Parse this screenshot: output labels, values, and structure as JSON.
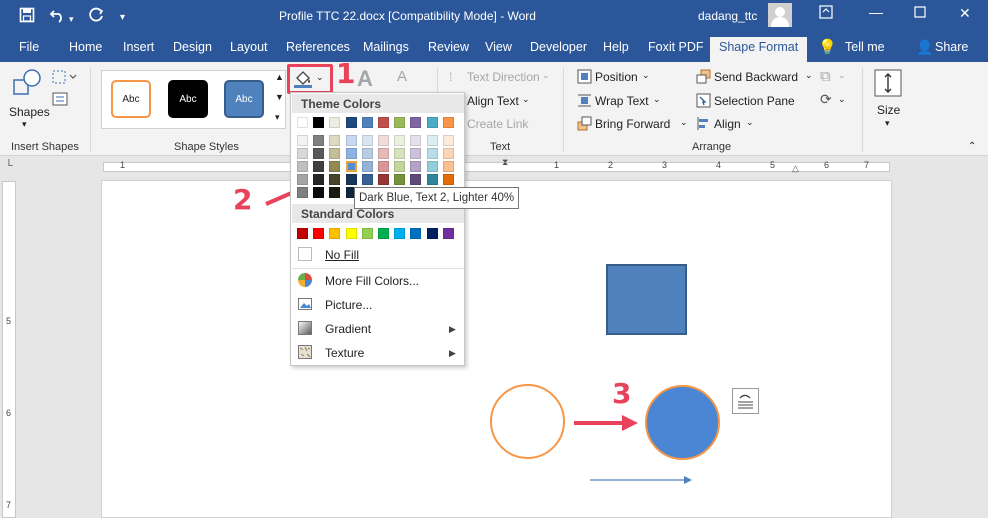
{
  "title_bar": {
    "document_title": "Profile TTC 22.docx [Compatibility Mode]  -  Word",
    "user_name": "dadang_ttc",
    "save_icon": "save-icon",
    "undo_icon": "undo-icon",
    "redo_icon": "redo-icon",
    "quick_access_icon": "customize-quick-access-icon"
  },
  "tabs": [
    "File",
    "Home",
    "Insert",
    "Design",
    "Layout",
    "References",
    "Mailings",
    "Review",
    "View",
    "Developer",
    "Help",
    "Foxit PDF",
    "Shape Format",
    "Tell me",
    "Share"
  ],
  "active_tab": "Shape Format",
  "ribbon": {
    "insert_shapes": {
      "shapes_label": "Shapes",
      "group_label": "Insert Shapes"
    },
    "shape_styles": {
      "style_label": "Abc",
      "group_label": "Shape Styles"
    },
    "text": {
      "text_direction": "Text Direction",
      "align_text": "Align Text",
      "create_link": "Create Link",
      "group_label": "Text"
    },
    "arrange": {
      "position": "Position",
      "wrap_text": "Wrap Text",
      "bring_forward": "Bring Forward",
      "send_backward": "Send Backward",
      "selection_pane": "Selection Pane",
      "align": "Align",
      "group_label": "Arrange"
    },
    "size": {
      "size_label": "Size"
    }
  },
  "fill_dropdown": {
    "theme_colors_header": "Theme Colors",
    "standard_colors_header": "Standard Colors",
    "theme_top_row": [
      "#ffffff",
      "#000000",
      "#eeece1",
      "#1f497d",
      "#4f81bd",
      "#c0504d",
      "#9bbb59",
      "#8064a2",
      "#4bacc6",
      "#f79646"
    ],
    "theme_shades": [
      [
        "#f2f2f2",
        "#7f7f7f",
        "#ddd9c3",
        "#c6d9f0",
        "#dbe5f1",
        "#f2dcdb",
        "#ebf1dd",
        "#e5e0ec",
        "#dbeef3",
        "#fdeada"
      ],
      [
        "#d8d8d8",
        "#595959",
        "#c4bd97",
        "#8db3e2",
        "#b8cce4",
        "#e5b9b7",
        "#d7e3bc",
        "#ccc1d9",
        "#b7dde8",
        "#fbd5b5"
      ],
      [
        "#bfbfbf",
        "#3f3f3f",
        "#938953",
        "#548dd4",
        "#95b3d7",
        "#d99694",
        "#c3d69b",
        "#b2a2c7",
        "#92cddc",
        "#fac08f"
      ],
      [
        "#a5a5a5",
        "#262626",
        "#494429",
        "#17365d",
        "#366092",
        "#953734",
        "#76923c",
        "#5f497a",
        "#31859b",
        "#e36c09"
      ],
      [
        "#7f7f7f",
        "#0c0c0c",
        "#1d1b10",
        "#0f243e",
        "#244061",
        "#632423",
        "#4f6128",
        "#3f3151",
        "#205867",
        "#974806"
      ]
    ],
    "standard_colors": [
      "#c00000",
      "#ff0000",
      "#ffc000",
      "#ffff00",
      "#92d050",
      "#00b050",
      "#00b0f0",
      "#0070c0",
      "#002060",
      "#7030a0"
    ],
    "no_fill": "No Fill",
    "more_fill_colors": "More Fill Colors...",
    "picture": "Picture...",
    "gradient": "Gradient",
    "texture": "Texture"
  },
  "tooltip": "Dark Blue, Text 2, Lighter 40%",
  "annotations": [
    "1",
    "2",
    "3"
  ],
  "ruler": {
    "h_numbers": [
      "1",
      "1",
      "2",
      "3",
      "4",
      "5",
      "6",
      "7"
    ],
    "v_numbers": [
      "5",
      "6",
      "7"
    ]
  },
  "colors": {
    "accent": "#2b579a",
    "shape_fill": "#4f81bd",
    "circle_fill": "#4a86d4",
    "circle_outline": "#f79646",
    "annotation": "#e8435a"
  }
}
